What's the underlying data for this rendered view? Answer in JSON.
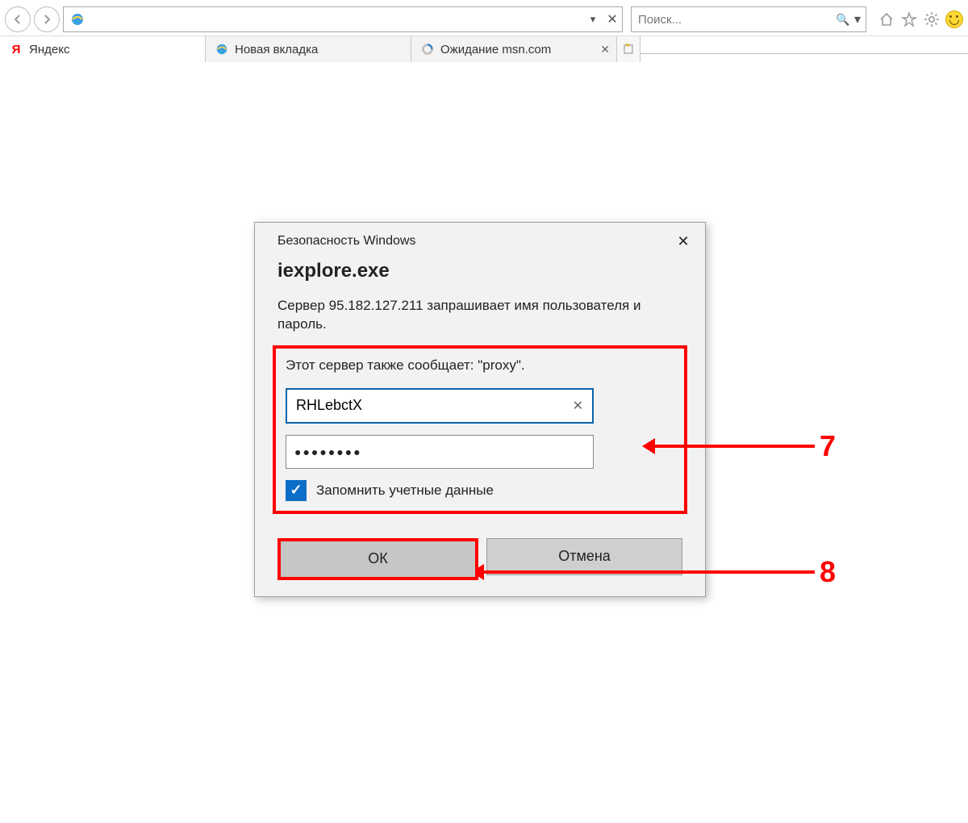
{
  "chrome": {
    "tabs": [
      {
        "label": "Яндекс"
      },
      {
        "label": "Новая вкладка"
      },
      {
        "label": "Ожидание msn.com"
      }
    ],
    "search_placeholder": "Поиск..."
  },
  "dialog": {
    "title": "Безопасность Windows",
    "app": "iexplore.exe",
    "message": "Сервер 95.182.127.211 запрашивает имя пользователя и пароль.",
    "realm": "Этот сервер также сообщает: \"proxy\".",
    "username": "RHLebctX",
    "password_mask": "●●●●●●●●",
    "remember_label": "Запомнить учетные данные",
    "ok_label": "ОК",
    "cancel_label": "Отмена"
  },
  "annotations": {
    "a1": "7",
    "a2": "8"
  }
}
